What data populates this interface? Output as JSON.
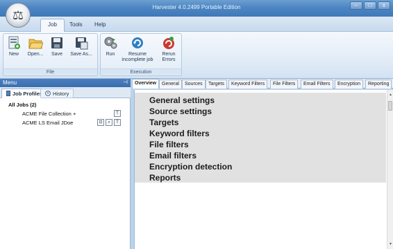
{
  "window": {
    "title": "Harvester 4.0.2499 Portable Edition",
    "controls": [
      "–",
      "□",
      "x"
    ]
  },
  "menu_tabs": [
    "Job",
    "Tools",
    "Help"
  ],
  "ribbon": {
    "file_group": {
      "label": "File",
      "buttons": [
        {
          "label": "New",
          "icon": "new-document-icon"
        },
        {
          "label": "Open...",
          "icon": "open-folder-icon"
        },
        {
          "label": "Save",
          "icon": "save-disk-icon"
        },
        {
          "label": "Save As...",
          "icon": "save-as-icon"
        }
      ]
    },
    "execution_group": {
      "label": "Execution",
      "buttons": [
        {
          "label": "Run",
          "icon": "run-gears-icon"
        },
        {
          "label": "Resume incomplete job",
          "icon": "resume-icon"
        },
        {
          "label": "Rerun Errors",
          "icon": "rerun-errors-icon"
        }
      ]
    }
  },
  "menu_panel": {
    "title": "Menu",
    "tabs": [
      "Job Profiles",
      "History"
    ],
    "tree": {
      "root": "All Jobs (2)",
      "jobs": [
        "ACME File Collection +",
        "ACME LS Email JDoe"
      ]
    }
  },
  "content_tabs": [
    "Overview",
    "General",
    "Sources",
    "Targets",
    "Keyword Filters",
    "File Filters",
    "Email Filters",
    "Encryption",
    "Reporting"
  ],
  "overview_items": [
    "General settings",
    "Source settings",
    "Targets",
    "Keyword filters",
    "File filters",
    "Email filters",
    "Encryption detection",
    "Reports"
  ],
  "colors": {
    "title_bar": "#4d86c3",
    "ribbon": "#dfeaf6",
    "menu_header": "#3a6eae",
    "overview_box": "#e1e1e1"
  }
}
